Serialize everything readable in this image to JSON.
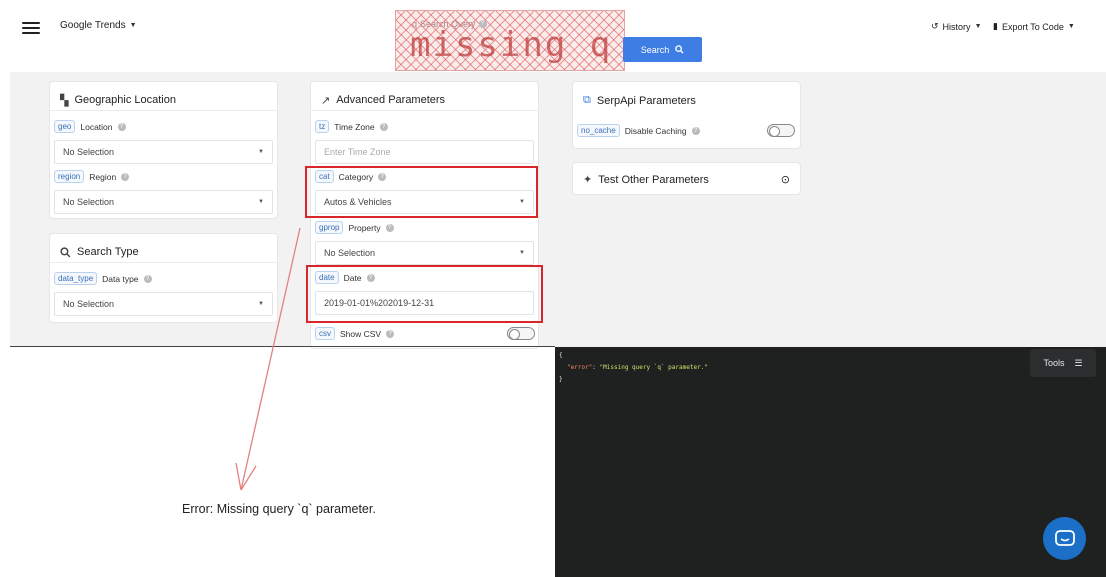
{
  "header": {
    "brand": "Google Trends",
    "search_label": "Search Query",
    "search_placeholder": "",
    "overlay_text": "missing q",
    "search_button": "Search",
    "history": "History",
    "export": "Export To Code"
  },
  "geo_card": {
    "title": "Geographic Location",
    "params": [
      {
        "tag": "geo",
        "label": "Location",
        "value": "No Selection"
      },
      {
        "tag": "region",
        "label": "Region",
        "value": "No Selection"
      }
    ]
  },
  "search_type_card": {
    "title": "Search Type",
    "params": [
      {
        "tag": "data_type",
        "label": "Data type",
        "value": "No Selection"
      }
    ]
  },
  "advanced_card": {
    "title": "Advanced Parameters",
    "tz": {
      "tag": "tz",
      "label": "Time Zone",
      "placeholder": "Enter Time Zone"
    },
    "cat": {
      "tag": "cat",
      "label": "Category",
      "value": "Autos & Vehicles"
    },
    "gprop": {
      "tag": "gprop",
      "label": "Property",
      "value": "No Selection"
    },
    "date": {
      "tag": "date",
      "label": "Date",
      "value": "2019-01-01%202019-12-31"
    },
    "csv": {
      "tag": "csv",
      "label": "Show CSV"
    }
  },
  "serpapi_card": {
    "title": "SerpApi Parameters",
    "no_cache": {
      "tag": "no_cache",
      "label": "Disable Caching"
    }
  },
  "test_card": {
    "title": "Test Other Parameters"
  },
  "code": {
    "line1": "{",
    "key": "\"error\"",
    "value": "\"Missing query `q` parameter.\"",
    "line3": "}"
  },
  "tools": "Tools",
  "error_message": "Error: Missing query `q` parameter.",
  "colors": {
    "accent": "#3d7de4",
    "highlight": "#d9262a",
    "code_bg": "#1f2020",
    "chat": "#1c6fc6"
  }
}
